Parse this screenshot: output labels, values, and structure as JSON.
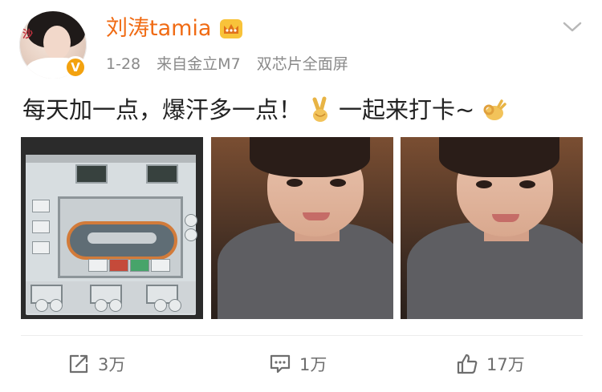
{
  "user": {
    "name": "刘涛tamia",
    "avatar_text": "沙",
    "verified_badge": "V",
    "crown_icon": "crown-icon"
  },
  "meta": {
    "date": "1-28",
    "source": "来自金立M7",
    "device_note": "双芯片全面屏"
  },
  "post": {
    "text_part1": "每天加一点，爆汗多一点！",
    "text_part2": "一起来打卡~",
    "emoji1": "victory-hand-icon",
    "emoji2": "ok-hand-icon"
  },
  "images": [
    {
      "subject": "treadmill-console"
    },
    {
      "subject": "selfie"
    },
    {
      "subject": "selfie"
    }
  ],
  "actions": {
    "share_count": "3万",
    "comment_count": "1万",
    "like_count": "17万"
  },
  "colors": {
    "username": "#f06b14",
    "meta": "#8a8a8a",
    "badge": "#f3a20f"
  }
}
